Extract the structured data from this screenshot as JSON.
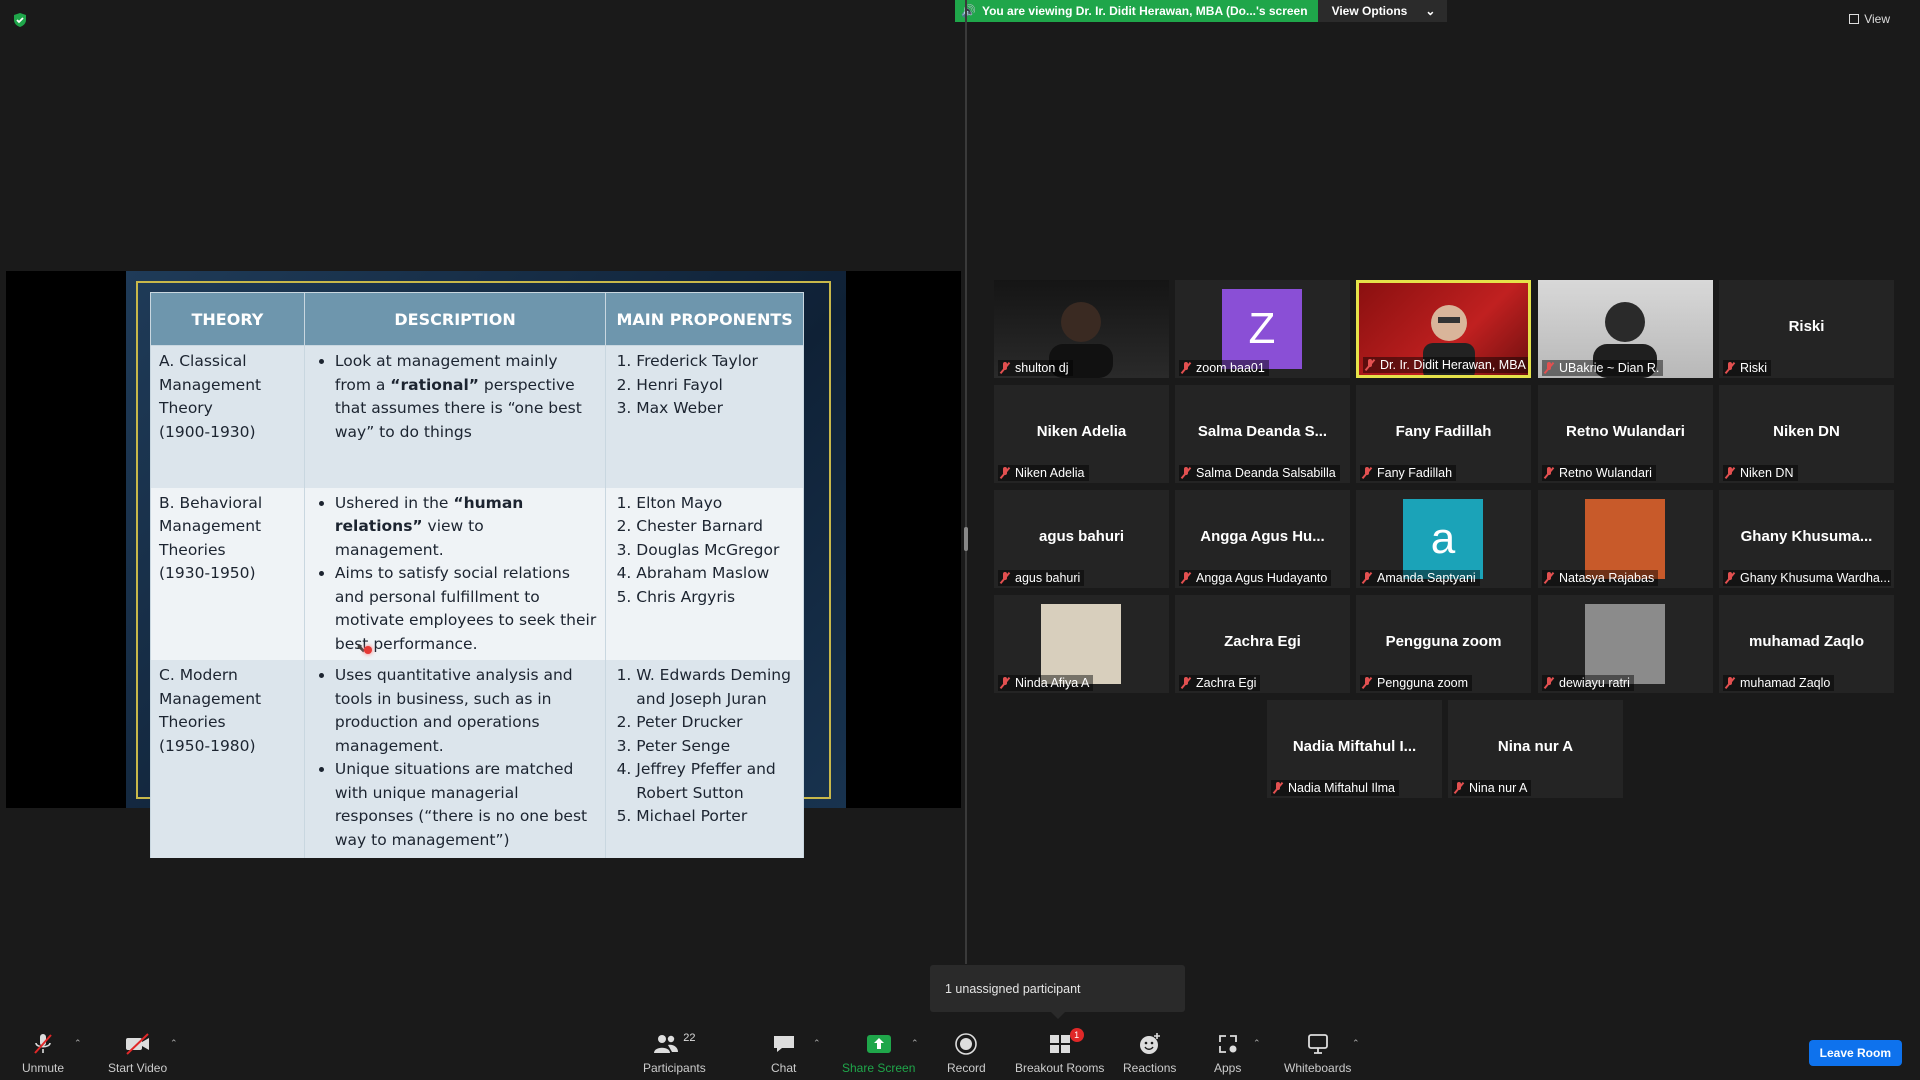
{
  "banner": {
    "message": "You are viewing Dr. Ir. Didit Herawan, MBA (Do...'s screen",
    "options_label": "View Options"
  },
  "view_label": "View",
  "slide": {
    "headers": [
      "THEORY",
      "DESCRIPTION",
      "MAIN PROPONENTS"
    ],
    "rows": [
      {
        "theory_letter": "A.",
        "theory_name": "Classical Management Theory",
        "theory_years": "(1900-1930)",
        "description": [
          [
            "Look at management mainly from a ",
            "“rational”",
            " perspective that assumes there is “one best way” to do things"
          ]
        ],
        "proponents": [
          "Frederick Taylor",
          "Henri Fayol",
          "Max Weber"
        ]
      },
      {
        "theory_letter": "B.",
        "theory_name": "Behavioral Management Theories",
        "theory_years": "(1930-1950)",
        "description": [
          [
            "Ushered in the ",
            "“human relations”",
            " view to management."
          ],
          [
            "Aims to satisfy social relations and personal fulfillment to motivate employees to seek their best performance.",
            "",
            ""
          ]
        ],
        "proponents": [
          "Elton Mayo",
          "Chester Barnard",
          "Douglas McGregor",
          "Abraham Maslow",
          "Chris Argyris"
        ]
      },
      {
        "theory_letter": "C.",
        "theory_name": "Modern Management Theories",
        "theory_years": "(1950-1980)",
        "description": [
          [
            "Uses quantitative analysis and tools in business, such as in production and operations management.",
            "",
            ""
          ],
          [
            "Unique situations are matched with unique managerial responses (“there is no one best way to management”)",
            "",
            ""
          ]
        ],
        "proponents": [
          "W. Edwards Deming and Joseph Juran",
          "Peter Drucker",
          "Peter Senge",
          "Jeffrey Pfeffer and Robert Sutton",
          "Michael Porter"
        ]
      }
    ]
  },
  "participants": [
    {
      "center": "",
      "label": "shulton dj",
      "type": "video"
    },
    {
      "center": "",
      "label": "zoom baa01",
      "type": "letter",
      "letter": "Z",
      "color": "#8a4fd6"
    },
    {
      "center": "",
      "label": "Dr. Ir. Didit Herawan, MBA (...",
      "type": "video-active"
    },
    {
      "center": "",
      "label": "UBakrie ~ Dian R.",
      "type": "video"
    },
    {
      "center": "Riski",
      "label": "Riski",
      "type": "name"
    },
    {
      "center": "Niken Adelia",
      "label": "Niken Adelia",
      "type": "name"
    },
    {
      "center": "Salma  Deanda  S...",
      "label": "Salma Deanda Salsabilla",
      "type": "name"
    },
    {
      "center": "Fany Fadillah",
      "label": "Fany Fadillah",
      "type": "name"
    },
    {
      "center": "Retno Wulandari",
      "label": "Retno Wulandari",
      "type": "name"
    },
    {
      "center": "Niken DN",
      "label": "Niken DN",
      "type": "name"
    },
    {
      "center": "agus bahuri",
      "label": "agus bahuri",
      "type": "name"
    },
    {
      "center": "Angga  Agus  Hu...",
      "label": "Angga Agus Hudayanto",
      "type": "name"
    },
    {
      "center": "",
      "label": "Amanda Saptyani",
      "type": "letter",
      "letter": "a",
      "color": "#1ba3b8"
    },
    {
      "center": "",
      "label": "Natasya Rajabas",
      "type": "image"
    },
    {
      "center": "Ghany  Khusuma...",
      "label": "Ghany Khusuma Wardha...",
      "type": "name"
    },
    {
      "center": "",
      "label": "Ninda Afiya A",
      "type": "image"
    },
    {
      "center": "Zachra Egi",
      "label": "Zachra Egi",
      "type": "name"
    },
    {
      "center": "Pengguna zoom",
      "label": "Pengguna zoom",
      "type": "name"
    },
    {
      "center": "",
      "label": "dewiayu ratri",
      "type": "image"
    },
    {
      "center": "muhamad Zaqlo",
      "label": "muhamad Zaqlo",
      "type": "name"
    },
    {
      "center": "Nadia  Miftahul  I...",
      "label": "Nadia Miftahul Ilma",
      "type": "name"
    },
    {
      "center": "Nina nur A",
      "label": "Nina nur A",
      "type": "name"
    }
  ],
  "popup": "1 unassigned participant",
  "toolbar": {
    "unmute": "Unmute",
    "start_video": "Start Video",
    "participants": "Participants",
    "participants_count": "22",
    "chat": "Chat",
    "share": "Share Screen",
    "record": "Record",
    "breakout": "Breakout Rooms",
    "breakout_badge": "1",
    "reactions": "Reactions",
    "apps": "Apps",
    "whiteboards": "Whiteboards",
    "leave": "Leave Room"
  },
  "colors": {
    "banner_green": "#1fa64a",
    "active_speaker": "#e5e24a",
    "share_green": "#1fa64a",
    "leave_blue": "#0e72ed"
  }
}
